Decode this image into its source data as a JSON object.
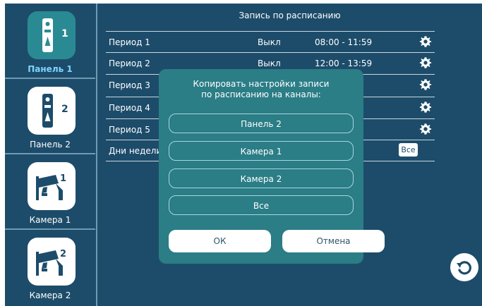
{
  "title": "Запись по расписанию",
  "sidebar": {
    "channels": [
      {
        "label": "Панель 1",
        "number": "1",
        "icon": "door-panel-icon",
        "active": true
      },
      {
        "label": "Панель 2",
        "number": "2",
        "icon": "door-panel-icon",
        "active": false
      },
      {
        "label": "Камера 1",
        "number": "1",
        "icon": "cctv-camera-icon",
        "active": false
      },
      {
        "label": "Камера 2",
        "number": "2",
        "icon": "cctv-camera-icon",
        "active": false
      }
    ]
  },
  "schedule": {
    "rows": [
      {
        "name": "Период 1",
        "status": "Выкл",
        "time": "08:00 - 11:59"
      },
      {
        "name": "Период 2",
        "status": "Выкл",
        "time": "12:00 - 13:59"
      },
      {
        "name": "Период 3",
        "status": "",
        "time": ""
      },
      {
        "name": "Период 4",
        "status": "",
        "time": ""
      },
      {
        "name": "Период 5",
        "status": "",
        "time": ""
      }
    ],
    "days_label": "Дни недели",
    "days_value": "Все"
  },
  "dialog": {
    "message_line1": "Копировать настройки записи",
    "message_line2": "по расписанию на каналы:",
    "options": [
      "Панель 2",
      "Камера 1",
      "Камера 2",
      "Все"
    ],
    "ok_label": "ОК",
    "cancel_label": "Отмена"
  },
  "colors": {
    "background": "#1d4c6a",
    "dialog": "#2b7d86",
    "active_tile": "#2a8a93",
    "active_label": "#7fd3ff"
  }
}
